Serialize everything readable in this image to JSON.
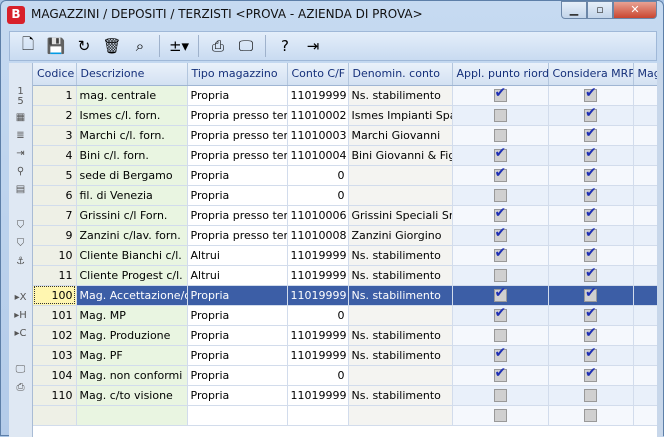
{
  "window": {
    "title": "MAGAZZINI / DEPOSITI / TERZISTI <PROVA - AZIENDA DI PROVA>",
    "app_icon": "B",
    "minimize": "▁",
    "maximize": "▫",
    "close": "✕"
  },
  "toolbar": [
    {
      "name": "new-icon",
      "glyph": "🗋"
    },
    {
      "name": "save-icon",
      "glyph": "💾"
    },
    {
      "name": "undo-icon",
      "glyph": "↻"
    },
    {
      "name": "delete-icon",
      "glyph": "🗑"
    },
    {
      "name": "search-binoculars-icon",
      "glyph": "⌕"
    },
    {
      "name": "calculator-dropdown-icon",
      "glyph": "±▾"
    },
    {
      "name": "print-icon",
      "glyph": "⎙"
    },
    {
      "name": "monitor-icon",
      "glyph": "🖵"
    },
    {
      "name": "help-icon",
      "glyph": "?"
    },
    {
      "name": "exit-icon",
      "glyph": "⇥"
    }
  ],
  "side_panel": {
    "page_top": "1",
    "page_bottom": "5",
    "icons": [
      "▦",
      "≣",
      "⇥",
      "⚲",
      "▤",
      "",
      "⛉",
      "⛉",
      "⚓",
      "",
      "▸X",
      "▸H",
      "▸C",
      "",
      "🖵",
      "⎙"
    ]
  },
  "columns": [
    "Codice",
    "Descrizione",
    "Tipo magazzino",
    "Conto C/F",
    "Denomin. conto",
    "Appl. punto riord.",
    "Considera MRP",
    "Mag"
  ],
  "rows": [
    {
      "codice": "1",
      "descrizione": "mag. centrale",
      "tipo": "Propria",
      "conto": "11019999",
      "denomin": "Ns. stabilimento",
      "appl": true,
      "mrp": true
    },
    {
      "codice": "2",
      "descrizione": "Ismes c/l. forn.",
      "tipo": "Propria presso terzi",
      "conto": "11010002",
      "denomin": "Ismes Impianti Spa",
      "appl": false,
      "mrp": true
    },
    {
      "codice": "3",
      "descrizione": "Marchi c/l. forn.",
      "tipo": "Propria presso terzi",
      "conto": "11010003",
      "denomin": "Marchi Giovanni",
      "appl": false,
      "mrp": true
    },
    {
      "codice": "4",
      "descrizione": "Bini c/l. forn.",
      "tipo": "Propria presso terzi",
      "conto": "11010004",
      "denomin": "Bini Giovanni & Figlio",
      "appl": true,
      "mrp": true
    },
    {
      "codice": "5",
      "descrizione": "sede di Bergamo",
      "tipo": "Propria",
      "conto": "0",
      "denomin": "",
      "appl": true,
      "mrp": true
    },
    {
      "codice": "6",
      "descrizione": "fil. di Venezia",
      "tipo": "Propria",
      "conto": "0",
      "denomin": "",
      "appl": false,
      "mrp": true
    },
    {
      "codice": "7",
      "descrizione": "Grissini c/l Forn.",
      "tipo": "Propria presso terzi",
      "conto": "11010006",
      "denomin": "Grissini Speciali Srl",
      "appl": true,
      "mrp": true
    },
    {
      "codice": "9",
      "descrizione": "Zanzini c/lav. forn.",
      "tipo": "Propria presso terzi",
      "conto": "11010008",
      "denomin": "Zanzini Giorgino",
      "appl": true,
      "mrp": true
    },
    {
      "codice": "10",
      "descrizione": "Cliente Bianchi c/l.",
      "tipo": "Altrui",
      "conto": "11019999",
      "denomin": "Ns. stabilimento",
      "appl": true,
      "mrp": true
    },
    {
      "codice": "11",
      "descrizione": "Cliente Progest c/l.",
      "tipo": "Altrui",
      "conto": "11019999",
      "denomin": "Ns. stabilimento",
      "appl": false,
      "mrp": true
    },
    {
      "codice": "100",
      "descrizione": "Mag. Accettazione/cq",
      "tipo": "Propria",
      "conto": "11019999",
      "denomin": "Ns. stabilimento",
      "appl": true,
      "mrp": true,
      "selected": true
    },
    {
      "codice": "101",
      "descrizione": "Mag. MP",
      "tipo": "Propria",
      "conto": "0",
      "denomin": "",
      "appl": true,
      "mrp": true
    },
    {
      "codice": "102",
      "descrizione": "Mag. Produzione",
      "tipo": "Propria",
      "conto": "11019999",
      "denomin": "Ns. stabilimento",
      "appl": false,
      "mrp": true
    },
    {
      "codice": "103",
      "descrizione": "Mag. PF",
      "tipo": "Propria",
      "conto": "11019999",
      "denomin": "Ns. stabilimento",
      "appl": true,
      "mrp": true
    },
    {
      "codice": "104",
      "descrizione": "Mag. non conformi",
      "tipo": "Propria",
      "conto": "0",
      "denomin": "",
      "appl": true,
      "mrp": true
    },
    {
      "codice": "110",
      "descrizione": "Mag. c/to visione",
      "tipo": "Propria",
      "conto": "11019999",
      "denomin": "Ns. stabilimento",
      "appl": false,
      "mrp": false
    },
    {
      "codice": "",
      "descrizione": "",
      "tipo": "",
      "conto": "",
      "denomin": "",
      "appl": false,
      "mrp": false
    }
  ]
}
